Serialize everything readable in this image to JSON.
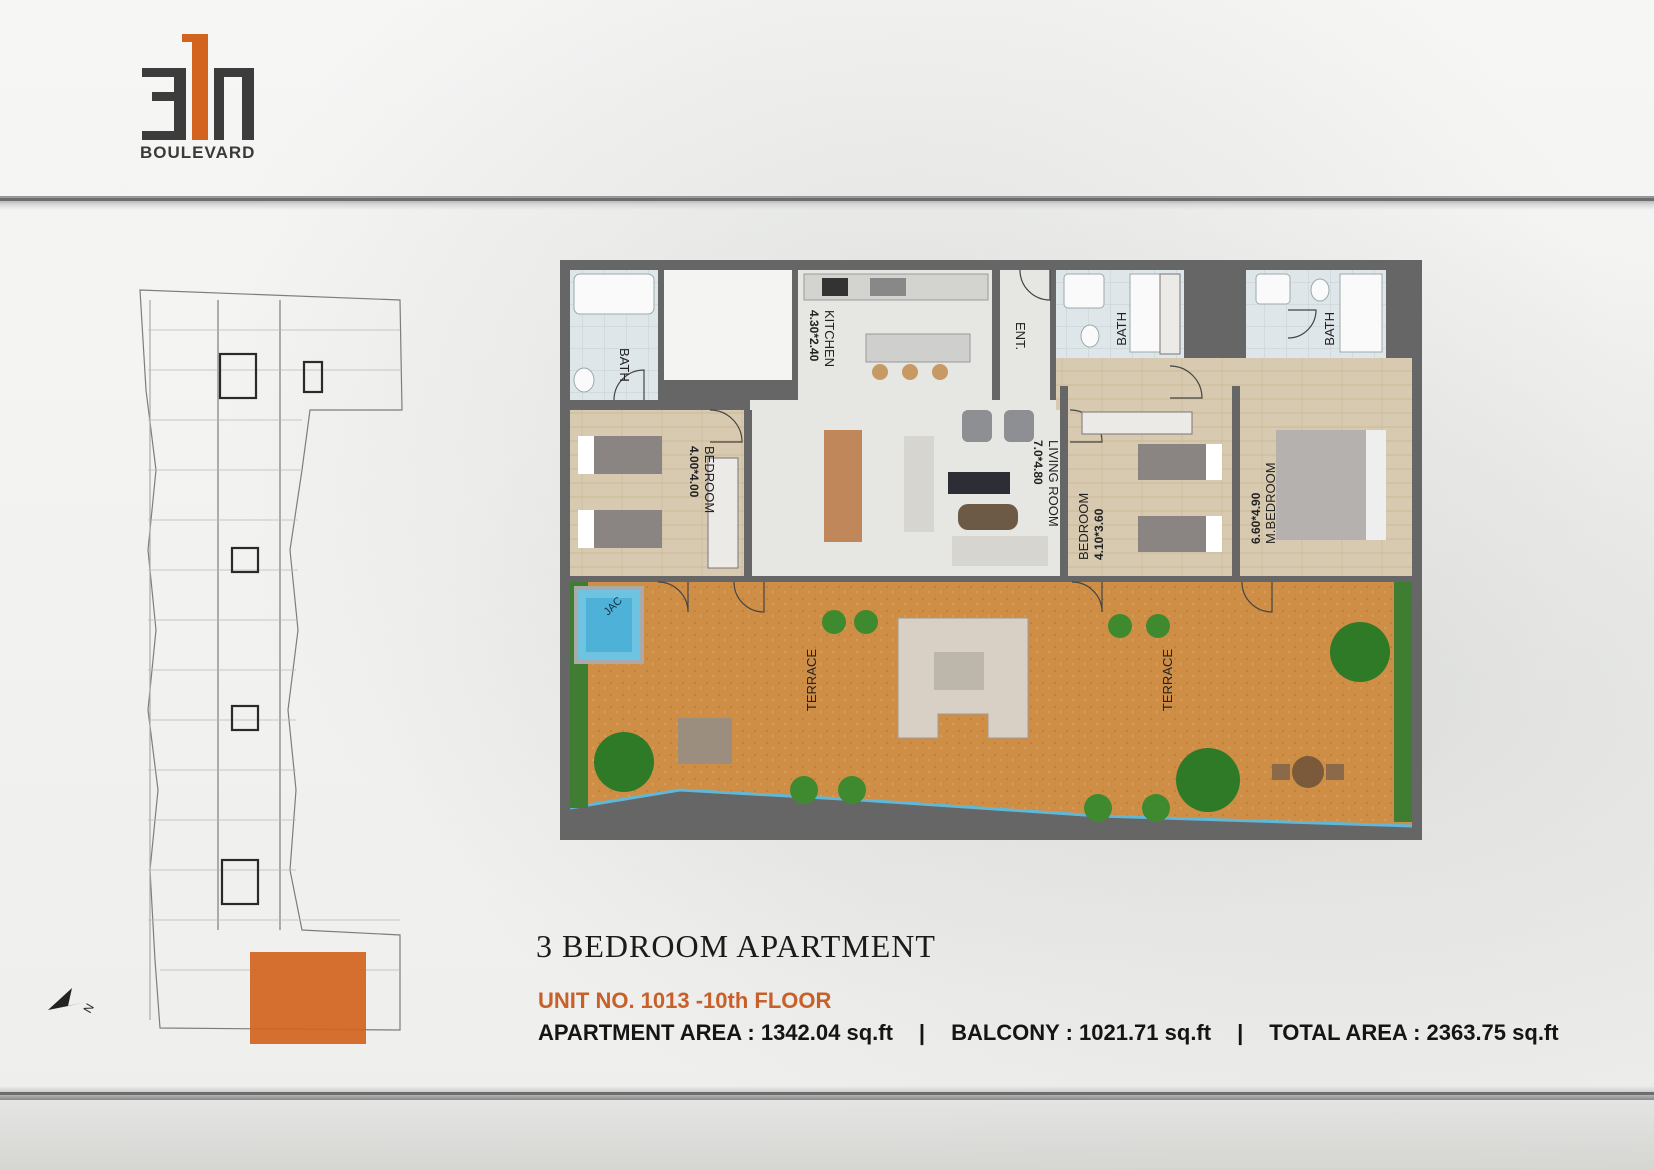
{
  "brand": {
    "logo_mark": "311",
    "logo_word": "BOULEVARD"
  },
  "key_plan": {
    "north_label": "N",
    "highlight_color": "#d2641f"
  },
  "floor_plan": {
    "rooms": {
      "bath_left": "BATH",
      "kitchen_dim": "4.30*2.40",
      "kitchen": "KITCHEN",
      "entrance": "ENT.",
      "bath_mid": "BATH",
      "bath_right": "BATH",
      "bedroom_left_dim": "4.00*4.00",
      "bedroom_left": "BEDROOM",
      "living_dim": "7.0*4.80",
      "living": "LIVING ROOM",
      "bedroom_mid": "BEDROOM",
      "bedroom_mid_dim": "4.10*3.60",
      "master_dim": "6.60*4.90",
      "master": "M.BEDROOM",
      "jacuzzi": "JAC",
      "terrace_left": "TERRACE",
      "terrace_right": "TERRACE"
    },
    "colors": {
      "wall": "#6b6b6b",
      "terrace": "#cf8e46",
      "wood_floor": "#d9cbb2",
      "marble_floor": "#e6e6e3",
      "tile_floor": "#dde4e8",
      "water": "#55b6dc"
    }
  },
  "title": "3  BEDROOM  APARTMENT",
  "unit_line": "UNIT NO.  1013 -10th FLOOR",
  "areas": {
    "apartment": "APARTMENT AREA : 1342.04 sq.ft",
    "separator": "|",
    "balcony": "BALCONY : 1021.71 sq.ft",
    "total": "TOTAL AREA : 2363.75 sq.ft"
  }
}
